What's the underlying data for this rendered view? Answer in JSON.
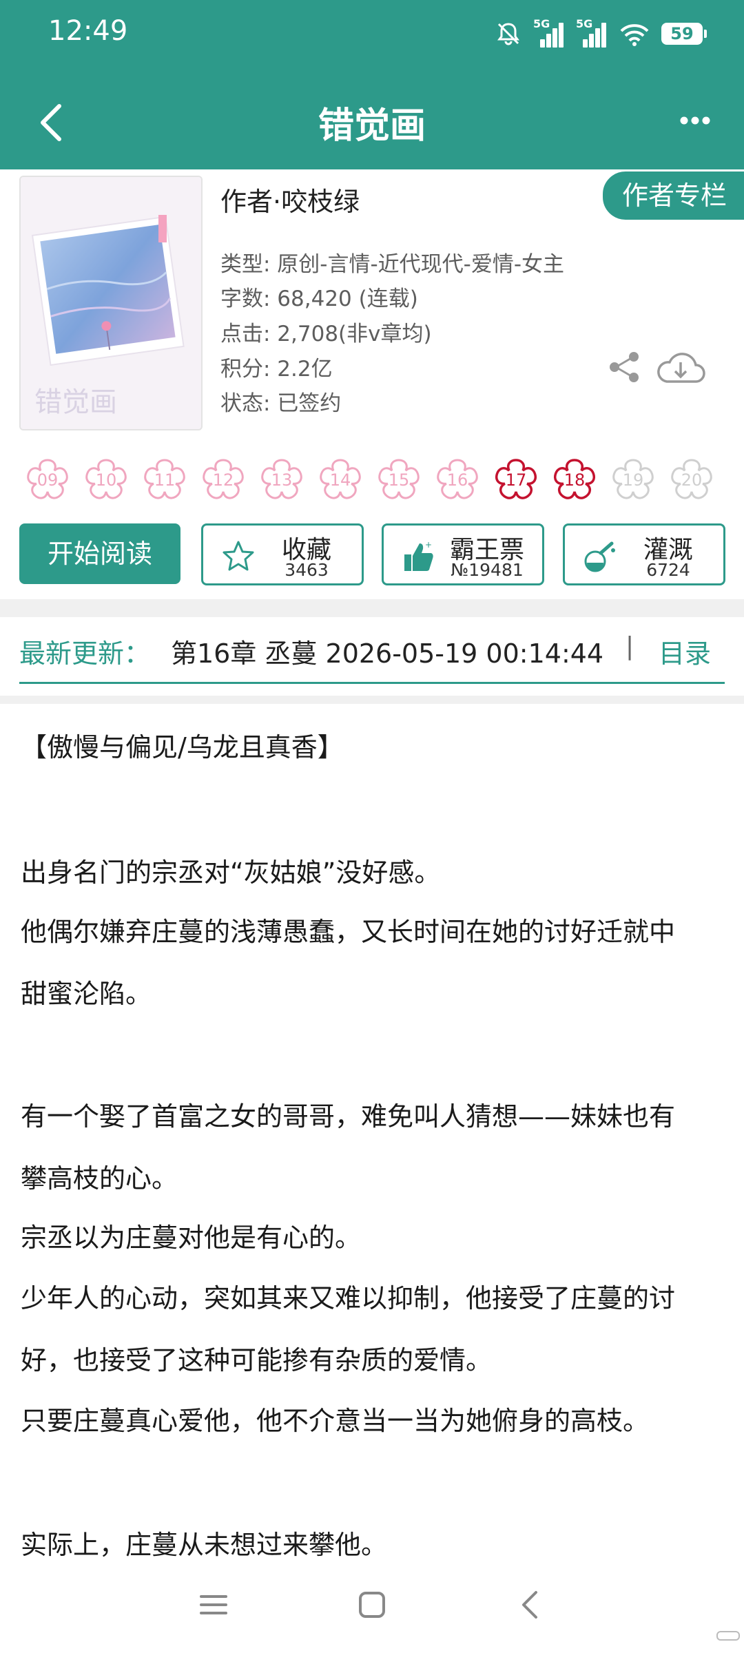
{
  "status_bar": {
    "time": "12:49",
    "network_1": "5G",
    "network_2": "5G",
    "battery": "59",
    "icons": [
      "mute-bell-icon",
      "signal-icon",
      "signal-icon",
      "wifi-icon",
      "battery-icon"
    ]
  },
  "header": {
    "title": "错觉画",
    "back_icon": "chevron-left-icon",
    "more_icon": "more-dots-icon"
  },
  "book": {
    "cover_title": "错觉画",
    "author_line": "作者·咬枝绿",
    "author_column_button": "作者专栏",
    "type": "类型: 原创-言情-近代现代-爱情-女主",
    "words": "字数: 68,420 (连载)",
    "clicks": "点击: 2,708(非v章均)",
    "score": "积分: 2.2亿",
    "status": "状态: 已签约"
  },
  "ratings": {
    "flowers": [
      {
        "label": "09",
        "state": "pink"
      },
      {
        "label": "10",
        "state": "pink"
      },
      {
        "label": "11",
        "state": "pink"
      },
      {
        "label": "12",
        "state": "pink"
      },
      {
        "label": "13",
        "state": "pink"
      },
      {
        "label": "14",
        "state": "pink"
      },
      {
        "label": "15",
        "state": "pink"
      },
      {
        "label": "16",
        "state": "pink"
      },
      {
        "label": "17",
        "state": "red"
      },
      {
        "label": "18",
        "state": "red"
      },
      {
        "label": "19",
        "state": "grey"
      },
      {
        "label": "20",
        "state": "grey"
      }
    ],
    "colors": {
      "pink": "#f0a6bf",
      "red": "#c4122f",
      "grey": "#cfcfcf"
    }
  },
  "actions": {
    "start_reading": "开始阅读",
    "favorite_label": "收藏",
    "favorite_count": "3463",
    "ticket_label": "霸王票",
    "ticket_count": "№19481",
    "water_label": "灌溉",
    "water_count": "6724"
  },
  "latest": {
    "label": "最新更新：",
    "text": "第16章  丞蔓  2026-05-19 00:14:44",
    "separator": "|",
    "toc": "目录"
  },
  "synopsis": {
    "lines": [
      "【傲慢与偏见/乌龙且真香】",
      "出身名门的宗丞对“灰姑娘”没好感。",
      "他偶尔嫌弃庄蔓的浅薄愚蠢，又长时间在她的讨好迁就中",
      "甜蜜沦陷。",
      "有一个娶了首富之女的哥哥，难免叫人猜想——妹妹也有",
      "攀高枝的心。",
      "宗丞以为庄蔓对他是有心的。",
      "少年人的心动，突如其来又难以抑制，他接受了庄蔓的讨",
      "好，也接受了这种可能掺有杂质的爱情。",
      "只要庄蔓真心爱他，他不介意当一当为她俯身的高枝。",
      "实际上，庄蔓从未想过来攀他。"
    ]
  },
  "accent_color": "#2d9a8a"
}
